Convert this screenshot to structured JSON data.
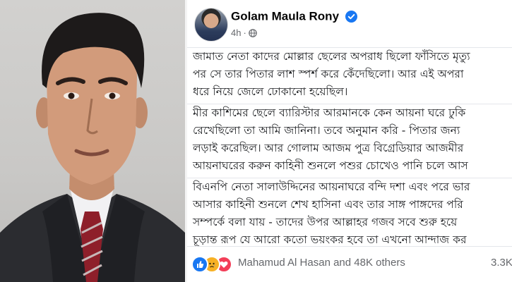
{
  "post": {
    "author": "Golam Maula Rony",
    "verified": true,
    "timestamp": "4h",
    "separator": "·",
    "audience_icon": "globe-icon",
    "paragraphs": [
      {
        "lines": [
          "জামাত নেতা কাদের মোল্লার ছেলের অপরাধ ছিলো ফাঁসিতে মৃত্যু",
          "পর সে তার পিতার লাশ স্পর্শ করে কেঁদেছিলো। আর এই অপরা",
          "ধরে নিয়ে জেলে ঢোকানো হয়েছিল।"
        ]
      },
      {
        "lines": [
          "মীর কাশিমের ছেলে ব্যারিস্টার আরমানকে কেন আয়না ঘরে ঢুকি",
          "রেখেছিলো তা আমি জানিনা। তবে অনুমান করি  - পিতার জন্য",
          "লড়াই করেছিল। আর গোলাম আজম পুত্র বিগ্রেডিয়ার আজমীর",
          "আয়নাঘরের করুন কাহিনী শুনলে পশুর চোখেও পানি চলে আস"
        ]
      },
      {
        "lines": [
          "বিএনপি নেতা সালাউদ্দিনের আয়নাঘরে বন্দি দশা এবং পরে ভার",
          "আসার কাহিনী শুনলে শেখ হাসিনা এবং তার সাঙ্গ পাঙ্গদের পরি",
          "সম্পর্কে বলা যায়  - তাদের উপর আল্লাহর গজব সবে শুরু হয়ে",
          "চূড়ান্ত রূপ যে আরো কতো ভয়ংকর হবে তা এখনো আন্দাজ কর"
        ]
      }
    ],
    "reactions": {
      "icons": [
        "like-icon",
        "sad-icon",
        "love-icon"
      ],
      "summary": "Mahamud Al Hasan and 48K others",
      "comments": "3.3K"
    }
  },
  "colors": {
    "facebook_blue": "#1877f2",
    "text": "#1c1e21",
    "meta": "#65676b",
    "divider": "#e4e6eb",
    "sad": "#f7b125",
    "love": "#f33e58"
  }
}
